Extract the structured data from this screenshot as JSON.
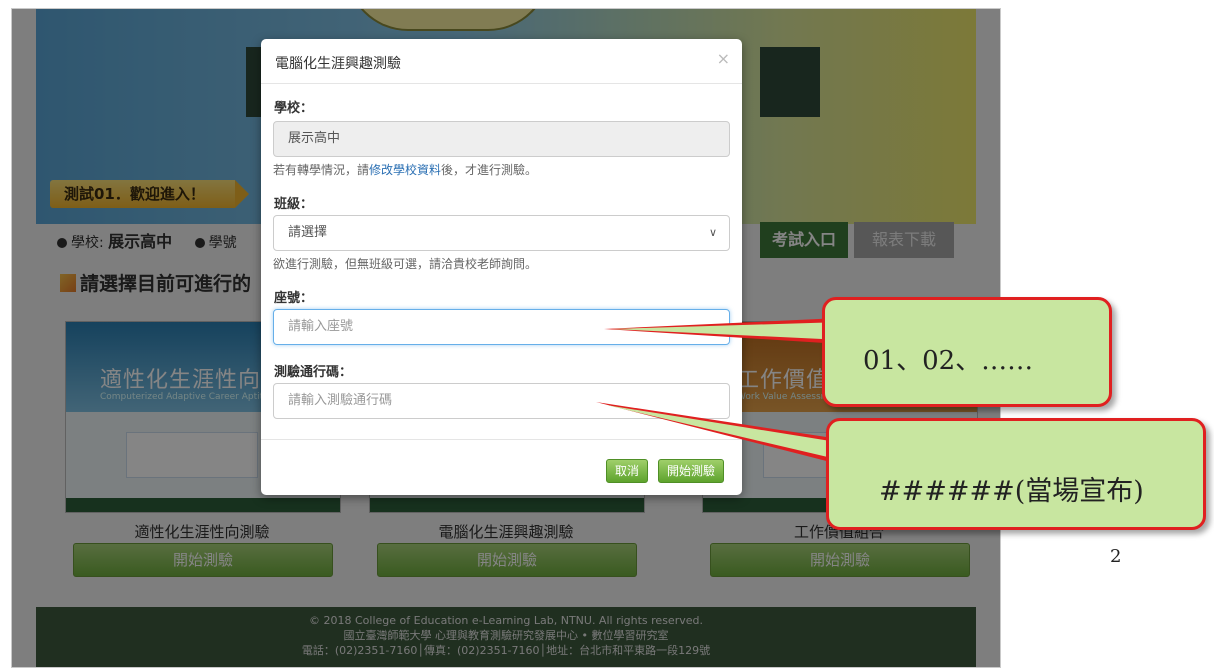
{
  "welcome_banner": "測試01．歡迎進入！",
  "info_bar": {
    "school_label": "學校:",
    "school_value": "展示高中",
    "student_label": "學號"
  },
  "tabs": {
    "exam": "考試入口",
    "report": "報表下載"
  },
  "section_title": "請選擇目前可進行的",
  "cards": [
    {
      "title": "適性化生涯性向測驗",
      "thumb_title": "適性化生涯性向測",
      "thumb_sub": "Computerized Adaptive Career Aptitude",
      "button": "開始測驗"
    },
    {
      "title": "電腦化生涯興趣測驗",
      "thumb_title": "",
      "thumb_sub": "",
      "button": "開始測驗"
    },
    {
      "title": "工作價值組合",
      "thumb_title": "工作價值",
      "thumb_sub": "Work Value Assessment",
      "button": "開始測驗"
    }
  ],
  "footer": {
    "line1": "© 2018 College of Education e-Learning Lab, NTNU. All rights reserved.",
    "line2": "國立臺灣師範大學 心理與教育測驗研究發展中心 • 數位學習研究室",
    "line3": "電話：(02)2351-7160│傳真：(02)2351-7160│地址：台北市和平東路一段129號"
  },
  "modal": {
    "title": "電腦化生涯興趣測驗",
    "close": "×",
    "school_label": "學校：",
    "school_value": "展示高中",
    "school_help_prefix": "若有轉學情況，請",
    "school_help_link": "修改學校資料",
    "school_help_suffix": "後，才進行測驗。",
    "class_label": "班級：",
    "class_value": "請選擇",
    "class_help": "欲進行測驗，但無班級可選，請洽貴校老師詢問。",
    "seat_label": "座號：",
    "seat_placeholder": "請輸入座號",
    "pass_label": "測驗通行碼：",
    "pass_placeholder": "請輸入測驗通行碼",
    "cancel": "取消",
    "start": "開始測驗"
  },
  "callouts": {
    "seat_note": "01、02、……",
    "pass_note": "######(當場宣布)"
  },
  "page_number": "2",
  "colors": {
    "callout_fill": "#c8e6a0",
    "callout_border": "#e02020",
    "green_button": "#6fae3e",
    "footer_bg": "#3e5a3e"
  }
}
